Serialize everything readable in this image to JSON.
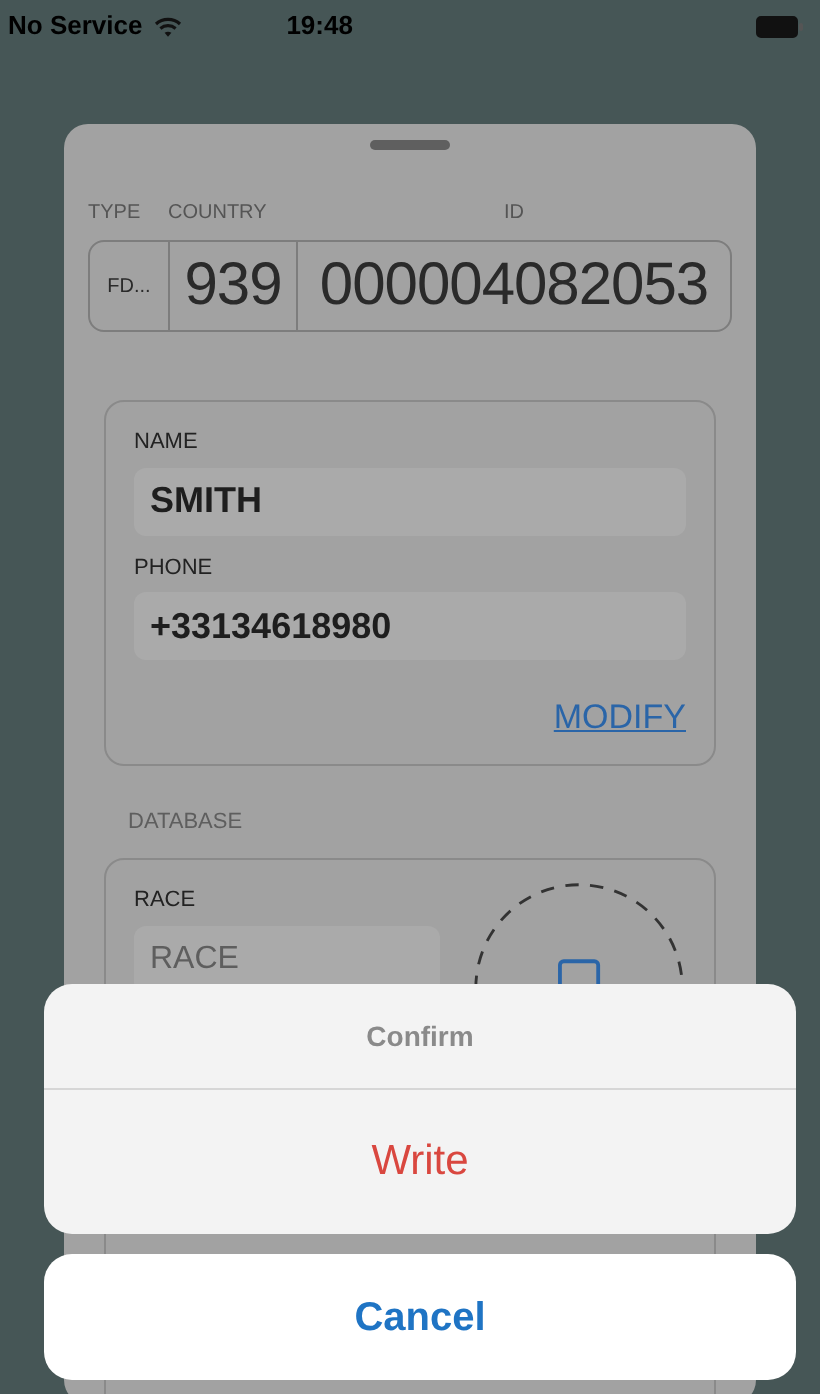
{
  "status_bar": {
    "carrier": "No Service",
    "time": "19:48"
  },
  "sheet": {
    "id_fields": [
      {
        "label": "TYPE",
        "value": "FD..."
      },
      {
        "label": "COUNTRY",
        "value": "939"
      },
      {
        "label": "ID",
        "value": "000004082053"
      }
    ],
    "contact": {
      "fields": [
        {
          "label": "NAME",
          "value": "SMITH"
        },
        {
          "label": "PHONE",
          "value": "+33134618980"
        }
      ],
      "modify_link": "MODIFY"
    },
    "database": {
      "section_label": "DATABASE",
      "race": {
        "label": "RACE",
        "placeholder": "RACE"
      }
    }
  },
  "action_sheet": {
    "title": "Confirm",
    "actions": [
      {
        "label": "Write",
        "kind": "destructive"
      }
    ],
    "cancel": "Cancel"
  }
}
